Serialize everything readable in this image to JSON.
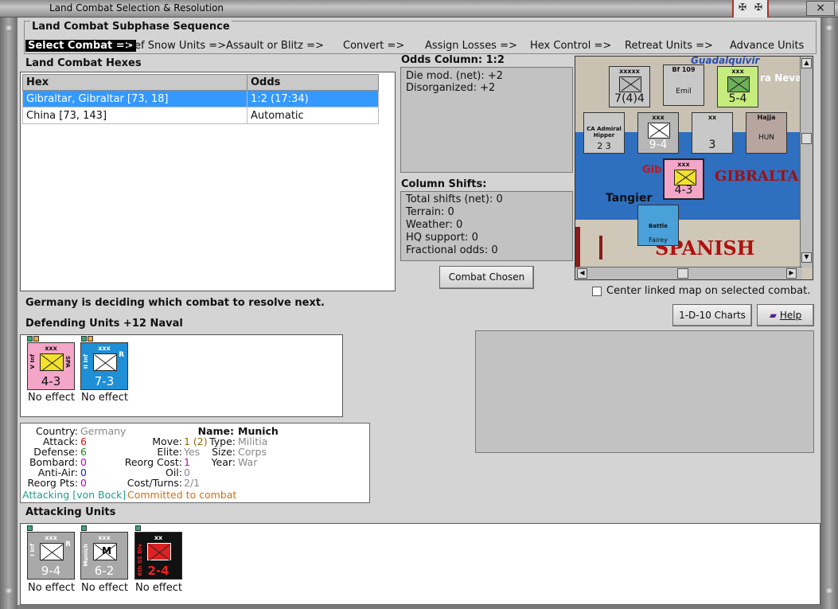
{
  "window": {
    "title": "Land Combat Selection & Resolution",
    "close_glyph": "×",
    "emblem_glyph": "✠"
  },
  "sequence": {
    "title": "Land Combat Subphase Sequence",
    "steps": [
      "Select Combat =>",
      "Def Snow Units =>",
      "Assault or Blitz =>",
      "Convert =>",
      "Assign Losses =>",
      "Hex Control =>",
      "Retreat Units =>",
      "Advance Units"
    ]
  },
  "hexes": {
    "title": "Land Combat Hexes",
    "columns": [
      "Hex",
      "Odds"
    ],
    "rows": [
      {
        "hex": "Gibraltar, Gibraltar [73, 18]",
        "odds": "1:2 (17:34)"
      },
      {
        "hex": "China [73, 143]",
        "odds": "Automatic"
      }
    ]
  },
  "odds": {
    "title": "Odds Column: 1:2",
    "lines": [
      "Die mod. (net): +2",
      "Disorganized: +2"
    ]
  },
  "shifts": {
    "title": "Column Shifts:",
    "lines": [
      "Total shifts (net): 0",
      "Terrain: 0",
      "Weather: 0",
      "HQ support: 0",
      "Fractional odds: 0"
    ]
  },
  "buttons": {
    "combat_chosen": "Combat Chosen",
    "charts": "1-D-10 Charts",
    "help": "Help"
  },
  "center_map_label": "Center linked map on selected combat.",
  "status_message": "Germany is deciding which combat to resolve next.",
  "map": {
    "labels": {
      "gibraltar": "GIBRALTA",
      "gib_short": "Gib",
      "tangier": "Tangier",
      "spanish": "SPANISH",
      "nevada": "ra Neva",
      "guadalquivir": "Guadalquivir"
    },
    "counters": [
      {
        "size": "xxxxx",
        "strength": "7(4)4",
        "top": "3"
      },
      {
        "size": "Bf 109",
        "strength": "Emil",
        "top": "3",
        "sub": "E"
      },
      {
        "size": "xxx",
        "strength": "5-4",
        "top": "3"
      },
      {
        "size": "CA Admiral Hipper",
        "strength": "2  3",
        "top": "2"
      },
      {
        "size": "xxx",
        "strength": "9-4",
        "top": "4"
      },
      {
        "size": "xx",
        "strength": "3",
        "top": "3"
      },
      {
        "size": "Hajja",
        "strength": "HUN",
        "top": "4"
      },
      {
        "size": "xxx",
        "strength": "4-3",
        "top": "2"
      },
      {
        "size": "Battle",
        "strength": "Fairey",
        "top": "4"
      }
    ]
  },
  "defending": {
    "title": "Defending Units +12 Naval",
    "units": [
      {
        "size": "xxx",
        "strength": "4-3",
        "side": "V Inf",
        "corner": "SPA",
        "result": "No effect",
        "color": "#f4a6c8"
      },
      {
        "size": "xxx",
        "strength": "7-3",
        "side": "II Inf",
        "corner": "R",
        "result": "No effect",
        "color": "#1f8fd6"
      }
    ]
  },
  "stats": {
    "country_label": "Country:",
    "country": "Germany",
    "attack_label": "Attack:",
    "attack": "6",
    "defense_label": "Defense:",
    "defense": "6",
    "bombard_label": "Bombard:",
    "bombard": "0",
    "antiair_label": "Anti-Air:",
    "antiair": "0",
    "reorg_pts_label": "Reorg Pts:",
    "reorg_pts": "0",
    "name_label": "Name:",
    "name": "Munich",
    "move_label": "Move:",
    "move": "1 (2)",
    "elite_label": "Elite:",
    "elite": "Yes",
    "reorg_cost_label": "Reorg Cost:",
    "reorg_cost": "1",
    "oil_label": "Oil:",
    "oil": "0",
    "cost_turns_label": "Cost/Turns:",
    "cost_turns": "2/1",
    "type_label": "Type:",
    "type": "Militia",
    "size_label": "Size:",
    "size": "Corps",
    "year_label": "Year:",
    "year": "War",
    "attacking_note": "Attacking [von Bock]",
    "committed_note": "Committed to combat",
    "colors": {
      "attack": "#d11",
      "defense": "#1a8a1a",
      "bombard": "#b0c",
      "antiair": "#22b",
      "reorg_pts": "#b0c",
      "move": "#8a6a00",
      "reorg_cost": "#b0c",
      "attacking_note": "#1aa08a",
      "committed_note": "#d07010"
    }
  },
  "attacking": {
    "title": "Attacking Units",
    "units": [
      {
        "size": "xxx",
        "strength": "9-4",
        "side": "I Inf",
        "corner": "R",
        "result": "No effect",
        "color": "#a9a9a9",
        "letter": ""
      },
      {
        "size": "xxx",
        "strength": "6-2",
        "side": "Munich",
        "corner": "",
        "result": "No effect",
        "color": "#a9a9a9",
        "letter": "M"
      },
      {
        "size": "xx",
        "strength": "2-4",
        "side": "6th SS Div",
        "corner": "",
        "result": "No effect",
        "color": "#111",
        "letter": ""
      }
    ]
  }
}
